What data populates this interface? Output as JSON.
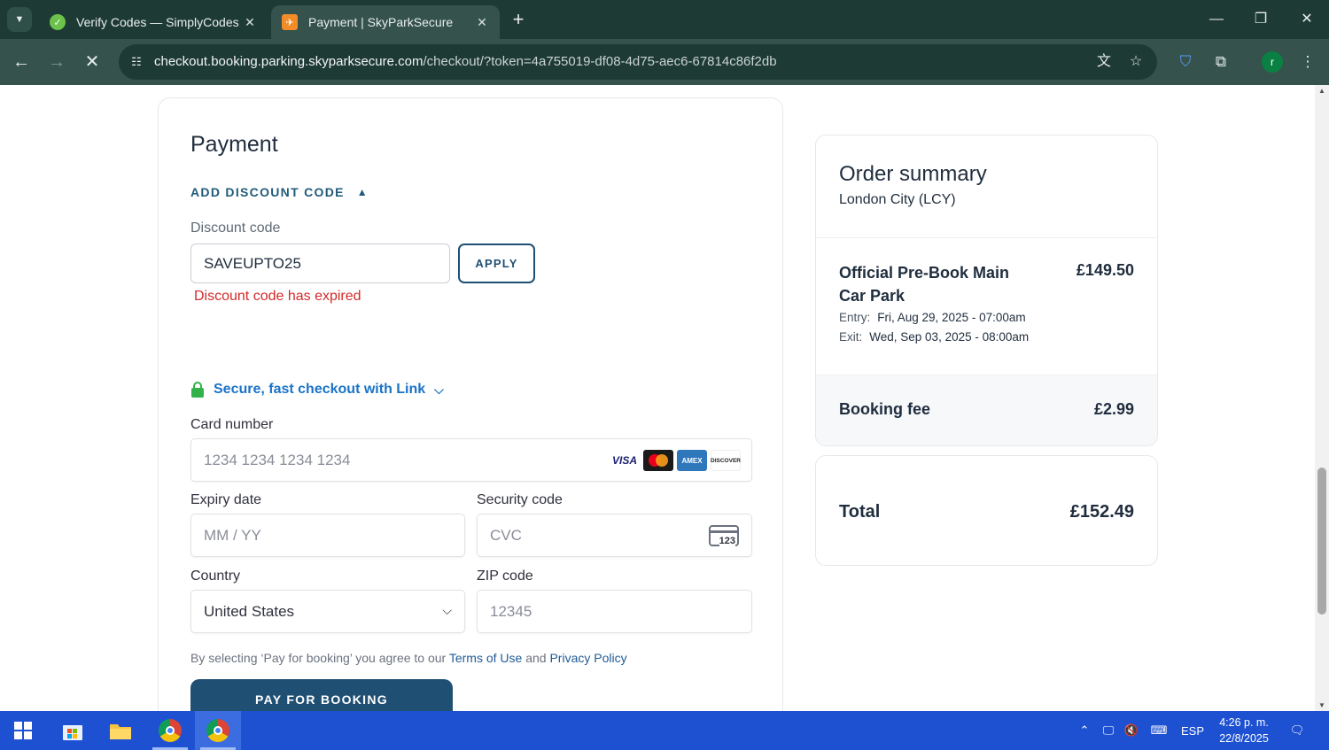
{
  "browser": {
    "tabs": [
      {
        "title": "Verify Codes — SimplyCodes",
        "active": false
      },
      {
        "title": "Payment | SkyParkSecure",
        "active": true
      }
    ],
    "url_host": "checkout.booking.parking.skyparksecure.com",
    "url_rest": "/checkout/?token=4a755019-df08-4d75-aec6-67814c86f2db",
    "profile_initial": "r",
    "accent": "#1e3a35"
  },
  "payment": {
    "title": "Payment",
    "discount_toggle": "ADD DISCOUNT CODE",
    "discount_label": "Discount code",
    "discount_value": "SAVEUPTO25",
    "apply_label": "APPLY",
    "discount_error": "Discount code has expired",
    "link_text": "Secure, fast checkout with Link",
    "card_number_label": "Card number",
    "card_number_placeholder": "1234 1234 1234 1234",
    "card_brands": [
      "VISA",
      "Mastercard",
      "AMEX",
      "DISCOVER"
    ],
    "expiry_label": "Expiry date",
    "expiry_placeholder": "MM / YY",
    "security_label": "Security code",
    "security_placeholder": "CVC",
    "cvc_icon_text": "123",
    "country_label": "Country",
    "country_value": "United States",
    "zip_label": "ZIP code",
    "zip_placeholder": "12345",
    "legal_prefix": "By selecting ‘Pay for booking’ you agree to our",
    "legal_terms": "Terms of Use",
    "legal_and": "and",
    "legal_privacy": "Privacy Policy",
    "pay_button": "PAY FOR BOOKING",
    "primary_color": "#1f4f73",
    "error_color": "#d42b2b"
  },
  "summary": {
    "title": "Order summary",
    "location": "London City (LCY)",
    "item_name": "Official Pre-Book Main Car Park",
    "item_price": "£149.50",
    "entry_label": "Entry:",
    "entry_value": "Fri, Aug 29, 2025 - 07:00am",
    "exit_label": "Exit:",
    "exit_value": "Wed, Sep 03, 2025 - 08:00am",
    "fee_label": "Booking fee",
    "fee_value": "£2.99",
    "total_label": "Total",
    "total_value": "£152.49"
  },
  "taskbar": {
    "language": "ESP",
    "time": "4:26 p. m.",
    "date": "22/8/2025"
  }
}
